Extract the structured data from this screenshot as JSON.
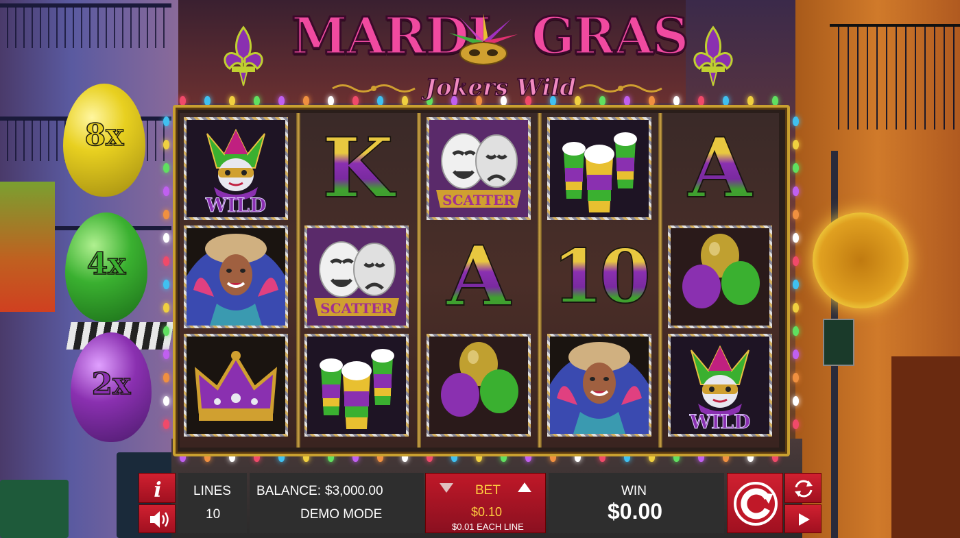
{
  "game": {
    "title_word1": "MARDI",
    "title_word2": "GRAS",
    "subtitle": "Jokers Wild"
  },
  "multipliers": [
    {
      "label": "8x",
      "color": "#e8d020"
    },
    {
      "label": "4x",
      "color": "#3ab030"
    },
    {
      "label": "2x",
      "color": "#8a30b0"
    }
  ],
  "reels": {
    "symbols": {
      "wild": "WILD",
      "scatter": "SCATTER",
      "king": "K",
      "ace": "A",
      "ten": "10"
    }
  },
  "controls": {
    "info_icon": "info-icon",
    "sound_icon": "speaker-icon",
    "lines_label": "LINES",
    "lines_value": "10",
    "balance_label": "BALANCE:",
    "balance_value": "$3,000.00",
    "mode_label": "DEMO MODE",
    "bet_label": "BET",
    "bet_value": "$0.10",
    "bet_per_line": "$0.01 EACH LINE",
    "win_label": "WIN",
    "win_value": "$0.00",
    "spin_icon": "spin-icon",
    "autoplay_icon": "autoplay-icon",
    "play_icon": "play-icon"
  },
  "colors": {
    "accent_red": "#c01828",
    "gold": "#c9a030",
    "purple": "#8a30b0",
    "green": "#3ab030"
  }
}
